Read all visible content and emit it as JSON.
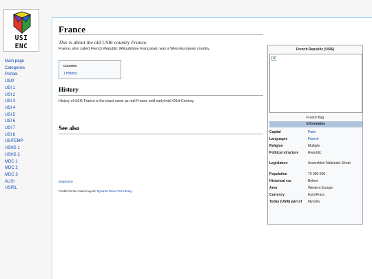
{
  "sidebar": {
    "logo": {
      "line1": "USI",
      "line2": "ENC"
    },
    "nav": [
      "Main page",
      "Categories",
      "Portals",
      "USI0",
      "USI 1",
      "USI 2",
      "USI 3",
      "USI 4",
      "USI 5",
      "USI 6",
      "USI 7",
      "USI 8",
      "USITEMP",
      "USHS 1",
      "USHS 2",
      "MDC 1",
      "MDC 2",
      "MDC 3",
      "AUSI",
      "USIRL"
    ]
  },
  "article": {
    "title": "France",
    "tagline": "This is about the old USI6 country France.",
    "intro_pre": "France, also called ",
    "intro_italic": "French Republic (République Française)",
    "intro_post": ", was a West-European country.",
    "toc": {
      "title": "Contents",
      "items": [
        "1 History"
      ]
    },
    "sections": {
      "history": {
        "heading": "History",
        "text": "History of USI6-France is the exact same as real France until early/mid XXIst Century."
      },
      "see_also": {
        "heading": "See also"
      }
    }
  },
  "footer": {
    "link": "Megahome",
    "credit_pre": "Credits for the column layout: ",
    "credit_link": "Dynamic Drive CSS Library"
  },
  "infobox": {
    "title": "French Republic (USI6)",
    "caption": "French flag",
    "header": "Information",
    "rows": [
      {
        "label": "Capital",
        "value": "Paris",
        "link": true
      },
      {
        "label": "Languages",
        "value": "French",
        "link": true
      },
      {
        "label": "Religion",
        "value": "Multiple",
        "link": false
      },
      {
        "label": "Political structure",
        "value": "Republic",
        "link": false
      },
      {
        "label": "Legislature",
        "value": "Assemblée Nationale Sénat",
        "link": false
      },
      {
        "label": "Population",
        "value": "70 000 000",
        "link": false
      },
      {
        "label": "Historical era",
        "value": "Before",
        "link": false
      },
      {
        "label": "Area",
        "value": "Western Europe",
        "link": false
      },
      {
        "label": "Currency",
        "value": "Euro/Franc",
        "link": false
      },
      {
        "label": "Today (USI6) part of",
        "value": "Mycelia",
        "link": false
      }
    ]
  },
  "colors": {
    "link": "#0645ad",
    "infobox_header": "#b0c4de",
    "sidebar_bg": "#f6f6f6"
  }
}
